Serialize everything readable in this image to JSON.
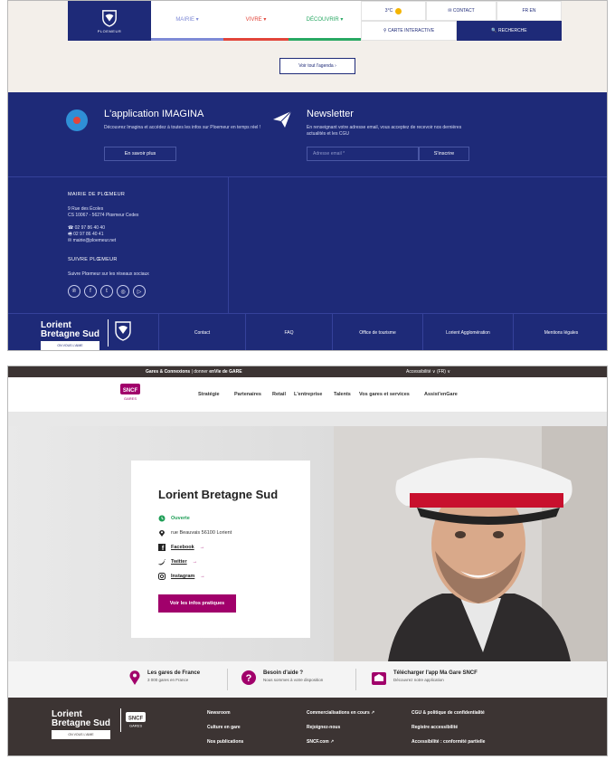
{
  "ploemeur": {
    "logo_text": "PLOEMEUR",
    "nav": [
      "MAIRIE ▾",
      "VIVRE ▾",
      "DÉCOUVRIR ▾"
    ],
    "weather": "3°C",
    "contact": "✉ CONTACT",
    "lang": "FR  EN",
    "map": "⚲ CARTE INTERACTIVE",
    "search": "🔍 RECHERCHE",
    "agenda": "Voir tout l'agenda ›",
    "app_title": "L'application IMAGINA",
    "app_desc": "Découvrez Imagina et accédez à toutes les infos sur Ploemeur en temps réel !",
    "app_button": "En savoir plus",
    "news_title": "Newsletter",
    "news_desc": "En renseignant votre adresse email, vous acceptez de recevoir nos dernières actualités et les CGU",
    "email_placeholder": "Adresse email *",
    "subscribe": "S'inscrire",
    "address_title": "MAIRIE DE PLŒMEUR",
    "address_1": "9 Rue des Écoles",
    "address_2": "CS 10067 - 56274 Plœmeur Cedex",
    "phone": "☎ 02 97 86 40 40",
    "fax": "🖷 02 97 86 40 41",
    "mail": "✉ mairie@ploemeur.net",
    "follow_title": "SUIVRE PLŒMEUR",
    "follow_desc": "Suivre Plœmeur sur les réseaux sociaux",
    "socials": [
      "℗",
      "f",
      "t",
      "◎",
      "▷"
    ],
    "foot_logo_1": "Lorient",
    "foot_logo_2": "Bretagne Sud",
    "foot_logo_sub": "ON VOUS L'AIME",
    "foot_shield_text": "PLOEMEUR",
    "footer_links": [
      "Contact",
      "FAQ",
      "Office de tourisme",
      "Lorient Agglomération",
      "Mentions légales"
    ]
  },
  "sncf": {
    "topbar_left_1": "Gares & Connexions",
    "topbar_left_2": " | donner ",
    "topbar_left_3": "enVie de GARE",
    "topbar_right": "Accessibilité  ∨  (FR)  ∨",
    "nav": [
      "Stratégie",
      "Partenaires",
      "Retail",
      "L'entreprise",
      "Talents",
      "Vos gares et services",
      "Assist'enGare"
    ],
    "station": "Lorient Bretagne Sud",
    "status": "Ouverte",
    "address": "rue Beauvais 56100 Lorient",
    "facebook": "Facebook",
    "twitter": "Twitter",
    "instagram": "Instagram",
    "arrow": "→",
    "cta": "Voir les infos pratiques",
    "info_1_title": "Les gares de France",
    "info_1_desc": "3 000 gares en France",
    "info_2_title": "Besoin d'aide ?",
    "info_2_desc": "Nous sommes à votre disposition",
    "info_3_title": "Télécharger l'app Ma Gare SNCF",
    "info_3_desc": "Découvrez notre application",
    "foot_logo_1": "Lorient",
    "foot_logo_2": "Bretagne Sud",
    "foot_logo_sub": "ON VOUS L'AIME",
    "footer_links": [
      "Newsroom",
      "Culture en gare",
      "Nos publications",
      "Commercialisations en cours ↗",
      "Rejoignez-nous",
      "SNCF.com ↗",
      "CGU & politique de confidentialité",
      "Registre accessibilité",
      "Accessibilité : conformité partielle"
    ]
  },
  "colors": {
    "ploemeur_blue": "#1e2a78",
    "sncf_magenta": "#a1006b",
    "sncf_brown": "#3c3433"
  }
}
